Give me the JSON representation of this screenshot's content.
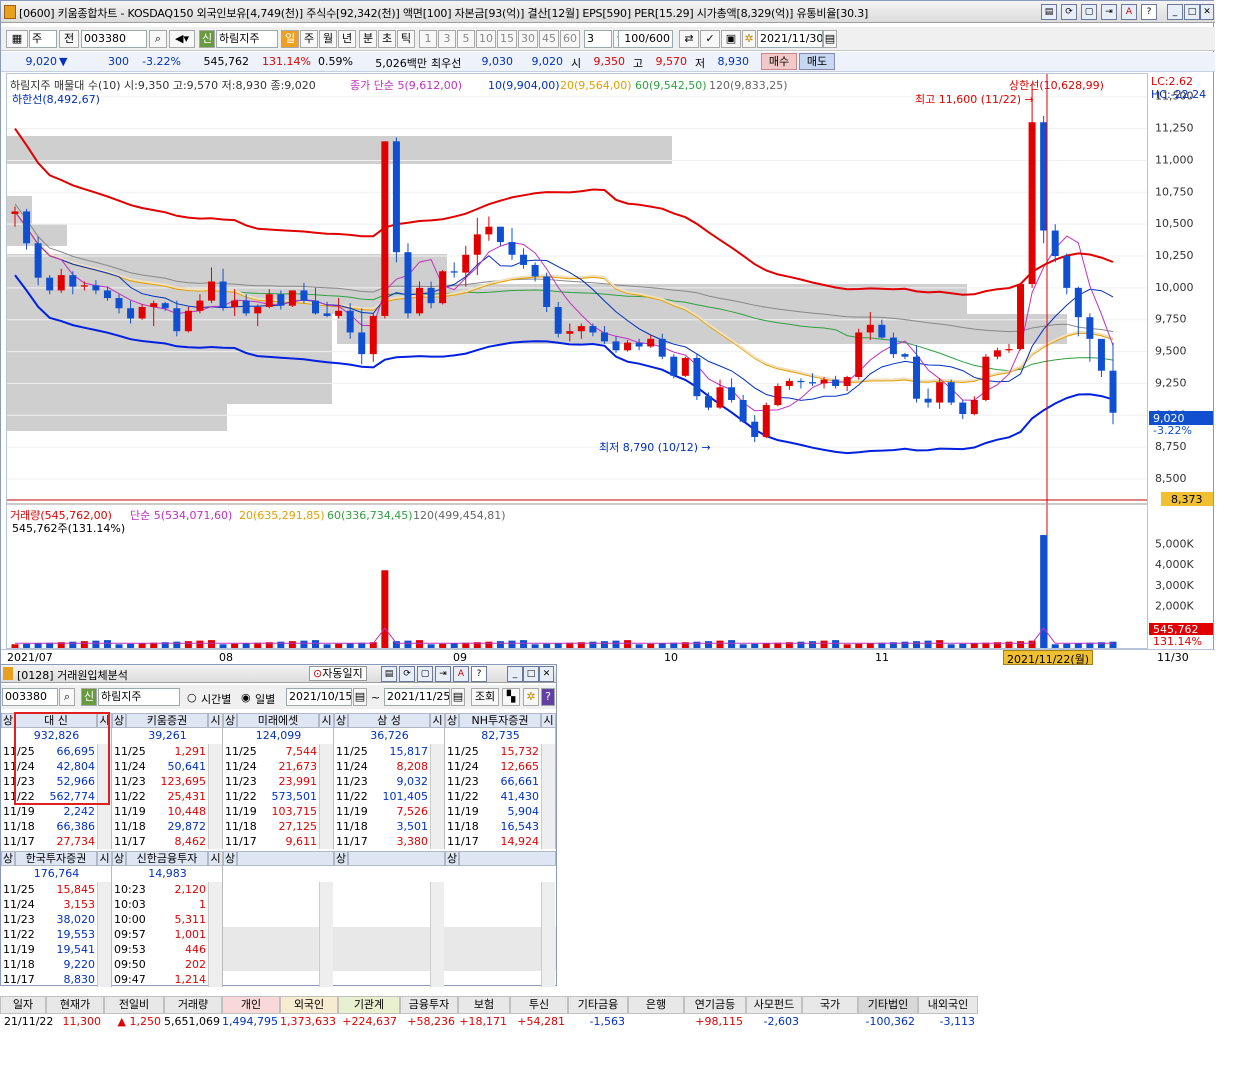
{
  "main_window": {
    "title": "[0600] 키움종합차트 - KOSDAQ150 외국인보유[4,749(천)] 주식수[92,342(천)] 액면[100] 자본금[93(억)] 결산[12월] EPS[590] PER[15.29] 시가총액[8,329(억)] 유통비율[30.3]",
    "toolbar": {
      "market": "주",
      "prev": "전",
      "code": "003380",
      "badge": "신",
      "name": "하림지주",
      "periods": [
        "일",
        "주",
        "월",
        "년",
        "분",
        "초",
        "틱"
      ],
      "nums": [
        "1",
        "3",
        "5",
        "10",
        "15",
        "30",
        "45",
        "60"
      ],
      "count": "3",
      "range": "100/600",
      "date": "2021/11/30"
    },
    "quote": {
      "price": "9,020",
      "change": "300",
      "rate": "-3.22%",
      "volume": "545,762",
      "vol_rate": "131.14%",
      "ratio": "0.59%",
      "amount": "5,026백만",
      "best": "최우선",
      "bid": "9,030",
      "ask": "9,020",
      "open_label": "시",
      "open": "9,350",
      "high_label": "고",
      "high": "9,570",
      "low_label": "저",
      "low": "8,930",
      "buy": "매수",
      "sell": "매도"
    }
  },
  "chart_data": {
    "type": "candlestick",
    "legend": [
      "하림지주 매물대 수(10)  시:9,350 고:9,570 저:8,930 종:9,020",
      "종가 단순 5(9,612,00)",
      "10(9,904,00)",
      "20(9,564,00)",
      "60(9,542,50)",
      "120(9,833,25)"
    ],
    "lower_band": "하한선(8,492,67)",
    "upper_band": "상한선(10,628,99)",
    "max_label": "최고 11,600 (11/22) →",
    "min_label": "최저 8,790 (10/12) →",
    "y_ticks": [
      "11,500",
      "11,250",
      "11,000",
      "10,750",
      "10,500",
      "10,250",
      "10,000",
      "9,750",
      "9,500",
      "9,250",
      "9,000",
      "8,750",
      "8,500"
    ],
    "lc": "LC:2.62",
    "hc": "HC:-22.24",
    "last_price": "9,020",
    "last_rate": "-3.22%",
    "ref_price": "8,373",
    "x_ticks": [
      "2021/07",
      "08",
      "09",
      "10",
      "11"
    ],
    "x_cursor": "2021/11/22(월)",
    "x_end": "11/30",
    "candles": [
      [
        10580,
        10640,
        10480,
        10600
      ],
      [
        10600,
        10620,
        10300,
        10350
      ],
      [
        10350,
        10400,
        10020,
        10080
      ],
      [
        10080,
        10100,
        9950,
        9980
      ],
      [
        9980,
        10150,
        9960,
        10100
      ],
      [
        10100,
        10130,
        9950,
        10010
      ],
      [
        10010,
        10050,
        9980,
        10020
      ],
      [
        10020,
        10060,
        9950,
        9980
      ],
      [
        9980,
        10010,
        9900,
        9920
      ],
      [
        9920,
        9950,
        9800,
        9840
      ],
      [
        9840,
        9900,
        9720,
        9760
      ],
      [
        9760,
        9870,
        9750,
        9850
      ],
      [
        9850,
        9900,
        9700,
        9880
      ],
      [
        9880,
        9890,
        9820,
        9840
      ],
      [
        9840,
        9900,
        9620,
        9660
      ],
      [
        9660,
        9850,
        9650,
        9820
      ],
      [
        9820,
        9950,
        9800,
        9900
      ],
      [
        9900,
        10160,
        9880,
        10050
      ],
      [
        10050,
        10150,
        9820,
        9850
      ],
      [
        9850,
        9990,
        9780,
        9900
      ],
      [
        9900,
        9950,
        9780,
        9800
      ],
      [
        9800,
        9870,
        9700,
        9850
      ],
      [
        9850,
        9990,
        9840,
        9950
      ],
      [
        9950,
        9980,
        9830,
        9860
      ],
      [
        9860,
        9980,
        9850,
        9980
      ],
      [
        9980,
        10040,
        9880,
        9900
      ],
      [
        9900,
        10000,
        9790,
        9800
      ],
      [
        9800,
        9890,
        9770,
        9780
      ],
      [
        9780,
        9920,
        9760,
        9820
      ],
      [
        9820,
        9880,
        9600,
        9650
      ],
      [
        9650,
        9840,
        9400,
        9480
      ],
      [
        9480,
        9800,
        9420,
        9780
      ],
      [
        9780,
        11150,
        9760,
        11150
      ],
      [
        11150,
        11180,
        10200,
        10280
      ],
      [
        10280,
        10350,
        9760,
        9800
      ],
      [
        9800,
        10050,
        9780,
        10000
      ],
      [
        10000,
        10050,
        9840,
        9880
      ],
      [
        9880,
        10140,
        9870,
        10130
      ],
      [
        10130,
        10200,
        10080,
        10120
      ],
      [
        10120,
        10330,
        10010,
        10260
      ],
      [
        10260,
        10550,
        10100,
        10420
      ],
      [
        10420,
        10560,
        10370,
        10480
      ],
      [
        10480,
        10480,
        10330,
        10360
      ],
      [
        10360,
        10470,
        10220,
        10260
      ],
      [
        10260,
        10310,
        10150,
        10180
      ],
      [
        10180,
        10200,
        10050,
        10090
      ],
      [
        10090,
        10120,
        9810,
        9850
      ],
      [
        9850,
        9890,
        9610,
        9640
      ],
      [
        9640,
        9720,
        9580,
        9660
      ],
      [
        9660,
        9720,
        9600,
        9700
      ],
      [
        9700,
        9720,
        9620,
        9650
      ],
      [
        9650,
        9700,
        9560,
        9580
      ],
      [
        9580,
        9620,
        9490,
        9510
      ],
      [
        9510,
        9590,
        9500,
        9570
      ],
      [
        9570,
        9600,
        9510,
        9540
      ],
      [
        9540,
        9630,
        9530,
        9600
      ],
      [
        9600,
        9640,
        9440,
        9460
      ],
      [
        9460,
        9480,
        9290,
        9310
      ],
      [
        9310,
        9460,
        9300,
        9450
      ],
      [
        9450,
        9480,
        9120,
        9150
      ],
      [
        9150,
        9180,
        9040,
        9060
      ],
      [
        9060,
        9280,
        9050,
        9220
      ],
      [
        9220,
        9290,
        9100,
        9120
      ],
      [
        9120,
        9160,
        8940,
        8950
      ],
      [
        8950,
        9000,
        8790,
        8830
      ],
      [
        8830,
        9100,
        8820,
        9080
      ],
      [
        9080,
        9250,
        9070,
        9230
      ],
      [
        9230,
        9290,
        9200,
        9270
      ],
      [
        9270,
        9290,
        9210,
        9260
      ],
      [
        9260,
        9330,
        9230,
        9250
      ],
      [
        9250,
        9300,
        9210,
        9280
      ],
      [
        9280,
        9310,
        9210,
        9230
      ],
      [
        9230,
        9310,
        9190,
        9300
      ],
      [
        9300,
        9680,
        9280,
        9650
      ],
      [
        9650,
        9810,
        9590,
        9710
      ],
      [
        9710,
        9750,
        9600,
        9610
      ],
      [
        9610,
        9650,
        9450,
        9480
      ],
      [
        9480,
        9490,
        9440,
        9460
      ],
      [
        9460,
        9550,
        9100,
        9130
      ],
      [
        9130,
        9210,
        9060,
        9100
      ],
      [
        9100,
        9290,
        9050,
        9260
      ],
      [
        9260,
        9280,
        9080,
        9100
      ],
      [
        9100,
        9120,
        8970,
        9010
      ],
      [
        9010,
        9150,
        9000,
        9120
      ],
      [
        9120,
        9480,
        9110,
        9460
      ],
      [
        9460,
        9530,
        9440,
        9510
      ],
      [
        9510,
        9560,
        9490,
        9520
      ],
      [
        9520,
        10030,
        9510,
        10030
      ],
      [
        10030,
        11600,
        10000,
        11300
      ],
      [
        11300,
        11350,
        10350,
        10450
      ],
      [
        10450,
        10500,
        10200,
        10250
      ],
      [
        10250,
        10270,
        9950,
        10000
      ],
      [
        10000,
        10010,
        9620,
        9770
      ],
      [
        9770,
        9800,
        9420,
        9600
      ],
      [
        9600,
        9570,
        9300,
        9350
      ],
      [
        9350,
        9570,
        8930,
        9020
      ]
    ],
    "volume_legend": [
      "거래량(545,762,00)",
      "단순 5(534,071,60)",
      "20(635,291,85)",
      "60(336,734,45)",
      "120(499,454,81)"
    ],
    "volume_sub": "545,762주(131.14%)",
    "volume_ticks": [
      "5,000K",
      "4,000K",
      "3,000K",
      "2,000K"
    ],
    "volume_last": "545,762",
    "volume_last_rate": "131.14%",
    "volume_spikes": [
      {
        "index": 32,
        "value": 3750
      },
      {
        "index": 89,
        "value": 5450
      }
    ]
  },
  "sub_window": {
    "title": "[0128] 거래원입체분석",
    "auto": "자동일지",
    "code": "003380",
    "badge": "신",
    "name": "하림지주",
    "mode_time": "시간별",
    "mode_day": "일별",
    "from": "2021/10/15",
    "to": "2021/11/25",
    "query": "조회",
    "brokers_top": [
      {
        "name": "대  신",
        "total": "932,826",
        "rows": [
          [
            "11/25",
            "66,695",
            "b"
          ],
          [
            "11/24",
            "42,804",
            "b"
          ],
          [
            "11/23",
            "52,966",
            "b"
          ],
          [
            "11/22",
            "562,774",
            "b"
          ],
          [
            "11/19",
            "2,242",
            "b"
          ],
          [
            "11/18",
            "66,386",
            "b"
          ],
          [
            "11/17",
            "27,734",
            "r"
          ]
        ]
      },
      {
        "name": "키움증권",
        "total": "39,261",
        "rows": [
          [
            "11/25",
            "1,291",
            "r"
          ],
          [
            "11/24",
            "50,641",
            "b"
          ],
          [
            "11/23",
            "123,695",
            "r"
          ],
          [
            "11/22",
            "25,431",
            "r"
          ],
          [
            "11/19",
            "10,448",
            "r"
          ],
          [
            "11/18",
            "29,872",
            "b"
          ],
          [
            "11/17",
            "8,462",
            "r"
          ]
        ]
      },
      {
        "name": "미래에셋",
        "total": "124,099",
        "rows": [
          [
            "11/25",
            "7,544",
            "r"
          ],
          [
            "11/24",
            "21,673",
            "r"
          ],
          [
            "11/23",
            "23,991",
            "r"
          ],
          [
            "11/22",
            "573,501",
            "b"
          ],
          [
            "11/19",
            "103,715",
            "r"
          ],
          [
            "11/18",
            "27,125",
            "r"
          ],
          [
            "11/17",
            "9,611",
            "r"
          ]
        ]
      },
      {
        "name": "삼  성",
        "total": "36,726",
        "rows": [
          [
            "11/25",
            "15,817",
            "b"
          ],
          [
            "11/24",
            "8,208",
            "r"
          ],
          [
            "11/23",
            "9,032",
            "b"
          ],
          [
            "11/22",
            "101,405",
            "b"
          ],
          [
            "11/19",
            "7,526",
            "r"
          ],
          [
            "11/18",
            "3,501",
            "b"
          ],
          [
            "11/17",
            "3,380",
            "r"
          ]
        ]
      },
      {
        "name": "NH투자증권",
        "total": "82,735",
        "rows": [
          [
            "11/25",
            "15,732",
            "r"
          ],
          [
            "11/24",
            "12,665",
            "r"
          ],
          [
            "11/23",
            "66,661",
            "b"
          ],
          [
            "11/22",
            "41,430",
            "b"
          ],
          [
            "11/19",
            "5,904",
            "b"
          ],
          [
            "11/18",
            "16,543",
            "b"
          ],
          [
            "11/17",
            "14,924",
            "r"
          ]
        ]
      }
    ],
    "brokers_bottom": [
      {
        "name": "한국투자증권",
        "total": "176,764",
        "rows": [
          [
            "11/25",
            "15,845",
            "r"
          ],
          [
            "11/24",
            "3,153",
            "r"
          ],
          [
            "11/23",
            "38,020",
            "b"
          ],
          [
            "11/22",
            "19,553",
            "b"
          ],
          [
            "11/19",
            "19,541",
            "b"
          ],
          [
            "11/18",
            "9,220",
            "b"
          ],
          [
            "11/17",
            "8,830",
            "b"
          ]
        ]
      },
      {
        "name": "신한금융투자",
        "total": "14,983",
        "rows": [
          [
            "10:23",
            "2,120",
            "r"
          ],
          [
            "10:03",
            "1",
            "r"
          ],
          [
            "10:00",
            "5,311",
            "r"
          ],
          [
            "09:57",
            "1,001",
            "r"
          ],
          [
            "09:53",
            "446",
            "r"
          ],
          [
            "09:50",
            "202",
            "r"
          ],
          [
            "09:47",
            "1,214",
            "r"
          ]
        ]
      }
    ],
    "col_sang": "상",
    "col_si": "시"
  },
  "investor_table": {
    "headers": [
      "일자",
      "현재가",
      "전일비",
      "거래량",
      "개인",
      "외국인",
      "기관계",
      "금융투자",
      "보험",
      "투신",
      "기타금융",
      "은행",
      "연기금등",
      "사모펀드",
      "국가",
      "기타법인",
      "내외국인"
    ],
    "row": [
      "21/11/22",
      "11,300",
      "▲ 1,250",
      "5,651,069",
      "1,494,795",
      "1,373,633",
      "+224,637",
      "+58,236",
      "+18,171",
      "+54,281",
      "-1,563",
      "",
      "+98,115",
      "-2,603",
      "",
      "-100,362",
      "-3,113"
    ]
  }
}
